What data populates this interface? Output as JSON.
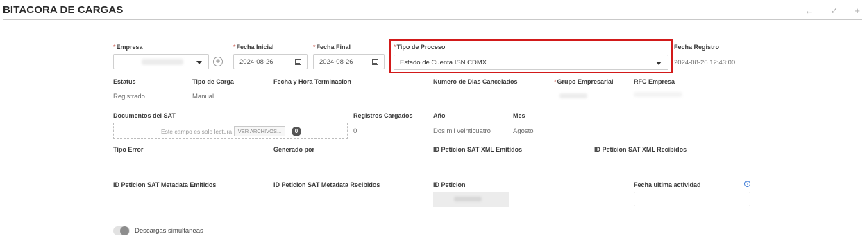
{
  "header": {
    "title": "BITACORA DE CARGAS",
    "back_icon": "←",
    "check_icon": "✓",
    "add_icon": "+"
  },
  "form": {
    "empresa": {
      "label": "Empresa",
      "required_mark": "*"
    },
    "plus_glyph": "+",
    "fecha_inicial": {
      "label": "Fecha Inicial",
      "required_mark": "*",
      "value": "2024-08-26"
    },
    "fecha_final": {
      "label": "Fecha Final",
      "required_mark": "*",
      "value": "2024-08-26"
    },
    "tipo_proceso": {
      "label": "Tipo de Proceso",
      "required_mark": "*",
      "value": "Estado de Cuenta ISN CDMX"
    },
    "fecha_registro": {
      "label": "Fecha Registro",
      "value": "2024-08-26 12:43:00"
    },
    "estatus": {
      "label": "Estatus",
      "value": "Registrado"
    },
    "tipo_carga": {
      "label": "Tipo de Carga",
      "value": "Manual"
    },
    "fecha_hora_terminacion": {
      "label": "Fecha y Hora Terminacion"
    },
    "dias_cancelados": {
      "label": "Numero de Dias Cancelados"
    },
    "grupo_empresarial": {
      "label": "Grupo Empresarial",
      "required_mark": "*"
    },
    "rfc_empresa": {
      "label": "RFC Empresa"
    },
    "documentos_sat": {
      "label": "Documentos del SAT",
      "readonly_text": "Este campo es solo lectura",
      "button_label": "VER ARCHIVOS...",
      "count": "0"
    },
    "registros_cargados": {
      "label": "Registros Cargados",
      "value": "0"
    },
    "anio": {
      "label": "Año",
      "value": "Dos mil veinticuatro"
    },
    "mes": {
      "label": "Mes",
      "value": "Agosto"
    },
    "tipo_error": {
      "label": "Tipo Error"
    },
    "generado_por": {
      "label": "Generado por"
    },
    "id_xml_emitidos": {
      "label": "ID Peticion SAT XML Emitidos"
    },
    "id_xml_recibidos": {
      "label": "ID Peticion SAT XML Recibidos"
    },
    "id_metadata_emitidos": {
      "label": "ID Peticion SAT Metadata Emitidos"
    },
    "id_metadata_recibidos": {
      "label": "ID Peticion SAT Metadata Recibidos"
    },
    "id_peticion": {
      "label": "ID Peticion"
    },
    "fecha_ultima_actividad": {
      "label": "Fecha ultima actividad",
      "help_glyph": "?"
    },
    "descargas_simultaneas": {
      "label": "Descargas simultaneas"
    }
  },
  "colors": {
    "highlight_border": "#d21a1a",
    "required_mark": "#c0392b",
    "help_icon": "#3d7bd6"
  }
}
